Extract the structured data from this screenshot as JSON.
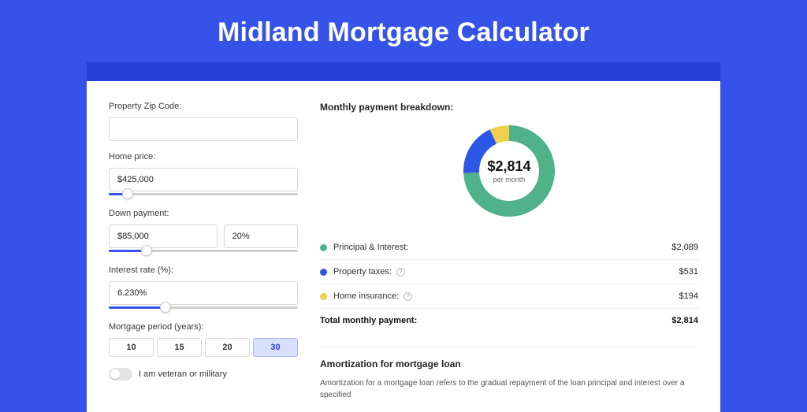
{
  "title": "Midland Mortgage Calculator",
  "form": {
    "zip": {
      "label": "Property Zip Code:",
      "value": ""
    },
    "home_price": {
      "label": "Home price:",
      "value": "$425,000",
      "slider_pct": 10
    },
    "down_payment": {
      "label": "Down payment:",
      "amount": "$85,000",
      "percent": "20%",
      "slider_pct": 20
    },
    "interest_rate": {
      "label": "Interest rate (%):",
      "value": "6.230%",
      "slider_pct": 30
    },
    "period": {
      "label": "Mortgage period (years):",
      "options": [
        "10",
        "15",
        "20",
        "30"
      ],
      "selected": "30"
    },
    "veteran": {
      "label": "I am veteran or military",
      "on": false
    }
  },
  "breakdown": {
    "title": "Monthly payment breakdown:",
    "total_amount": "$2,814",
    "total_sub": "per month",
    "rows": [
      {
        "label": "Principal & Interest:",
        "value": "$2,089",
        "color": "#4fb28b",
        "info": false
      },
      {
        "label": "Property taxes:",
        "value": "$531",
        "color": "#2d57e6",
        "info": true
      },
      {
        "label": "Home insurance:",
        "value": "$194",
        "color": "#f2ce4e",
        "info": true
      }
    ],
    "total_row": {
      "label": "Total monthly payment:",
      "value": "$2,814"
    }
  },
  "chart_data": {
    "type": "pie",
    "title": "Monthly payment breakdown",
    "series": [
      {
        "name": "Principal & Interest",
        "value": 2089,
        "color": "#4fb28b"
      },
      {
        "name": "Property taxes",
        "value": 531,
        "color": "#2d57e6"
      },
      {
        "name": "Home insurance",
        "value": 194,
        "color": "#f2ce4e"
      }
    ],
    "center_label": "$2,814",
    "center_sub": "per month"
  },
  "amortization": {
    "title": "Amortization for mortgage loan",
    "text": "Amortization for a mortgage loan refers to the gradual repayment of the loan principal and interest over a specified"
  }
}
